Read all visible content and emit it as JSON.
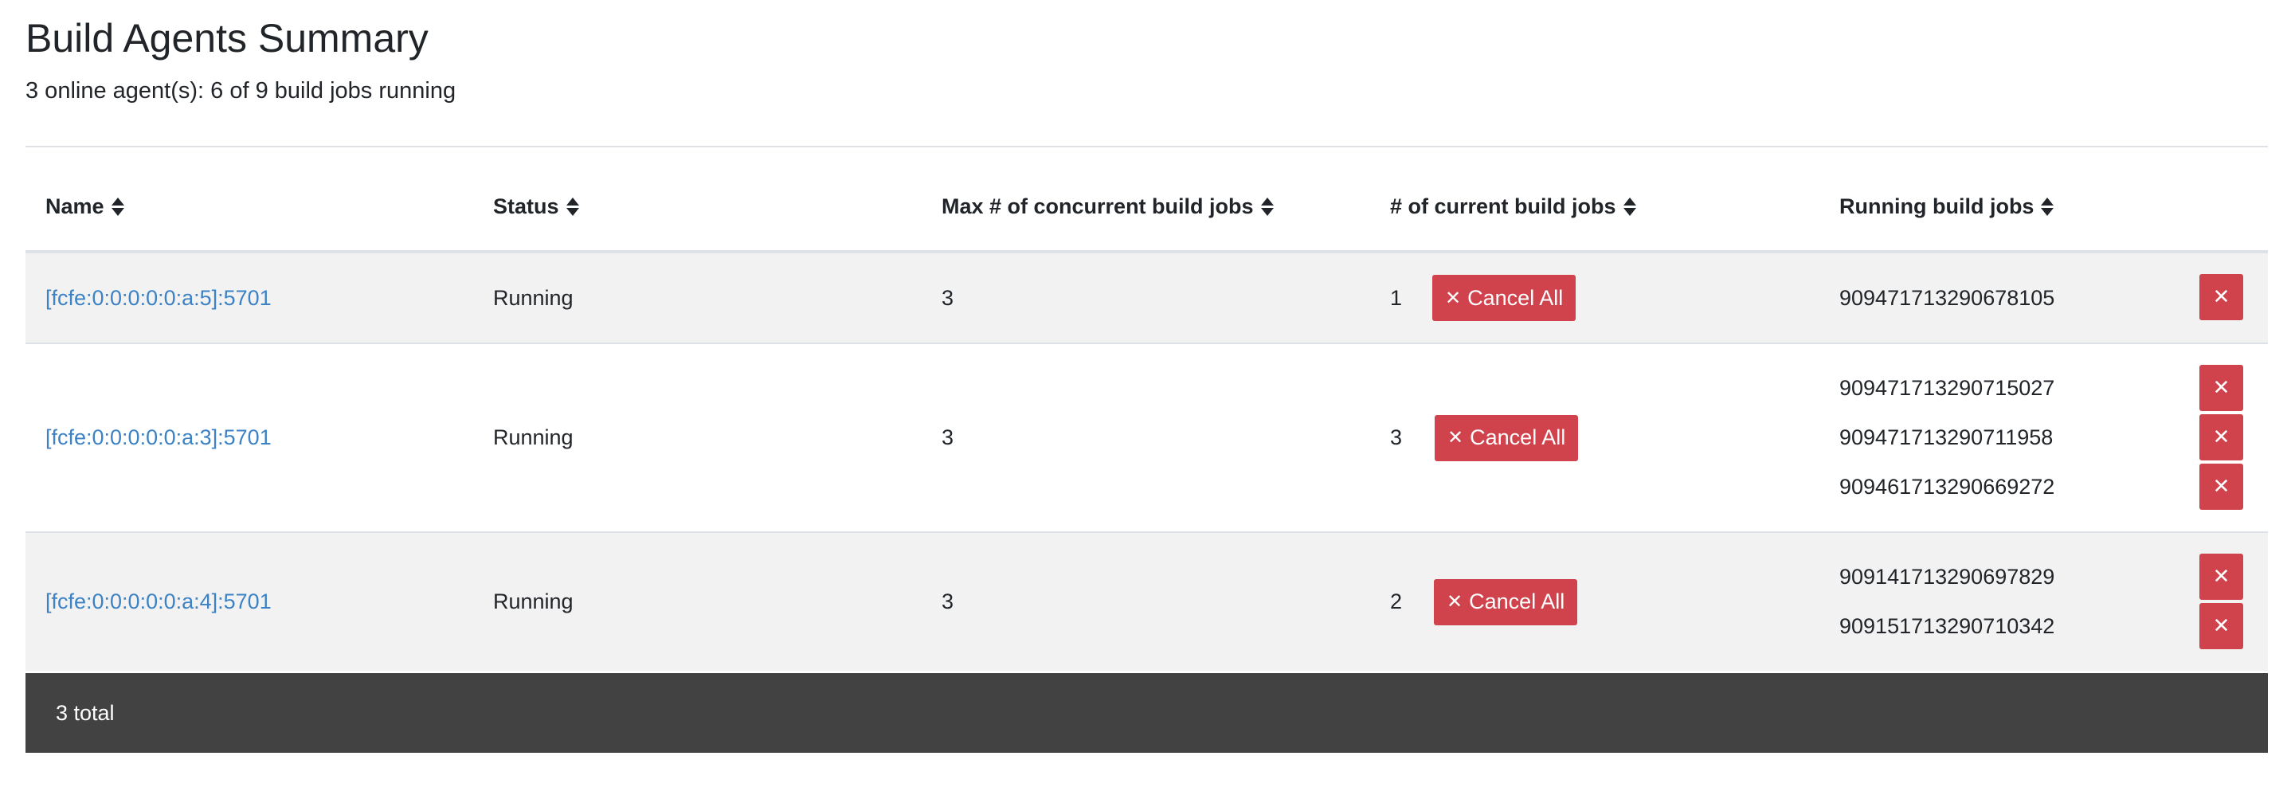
{
  "page": {
    "title": "Build Agents Summary",
    "subtitle": "3 online agent(s): 6 of 9 build jobs running"
  },
  "table": {
    "columns": [
      "Name",
      "Status",
      "Max # of concurrent build jobs",
      "# of current build jobs",
      "Running build jobs"
    ],
    "rows": [
      {
        "name": "[fcfe:0:0:0:0:0:a:5]:5701",
        "status": "Running",
        "max_jobs": "3",
        "current_jobs": "1",
        "cancel_all_label": "Cancel All",
        "running_jobs": [
          "909471713290678105"
        ]
      },
      {
        "name": "[fcfe:0:0:0:0:0:a:3]:5701",
        "status": "Running",
        "max_jobs": "3",
        "current_jobs": "3",
        "cancel_all_label": "Cancel All",
        "running_jobs": [
          "909471713290715027",
          "909471713290711958",
          "909461713290669272"
        ]
      },
      {
        "name": "[fcfe:0:0:0:0:0:a:4]:5701",
        "status": "Running",
        "max_jobs": "3",
        "current_jobs": "2",
        "cancel_all_label": "Cancel All",
        "running_jobs": [
          "909141713290697829",
          "909151713290710342"
        ]
      }
    ]
  },
  "footer": {
    "total_label": "3 total"
  },
  "icons": {
    "sort": "sort-icon",
    "cancel": "times-icon"
  },
  "colors": {
    "danger": "#d0434d",
    "link": "#3c82c4",
    "footer_bg": "#424242",
    "stripe": "#f2f2f2"
  }
}
